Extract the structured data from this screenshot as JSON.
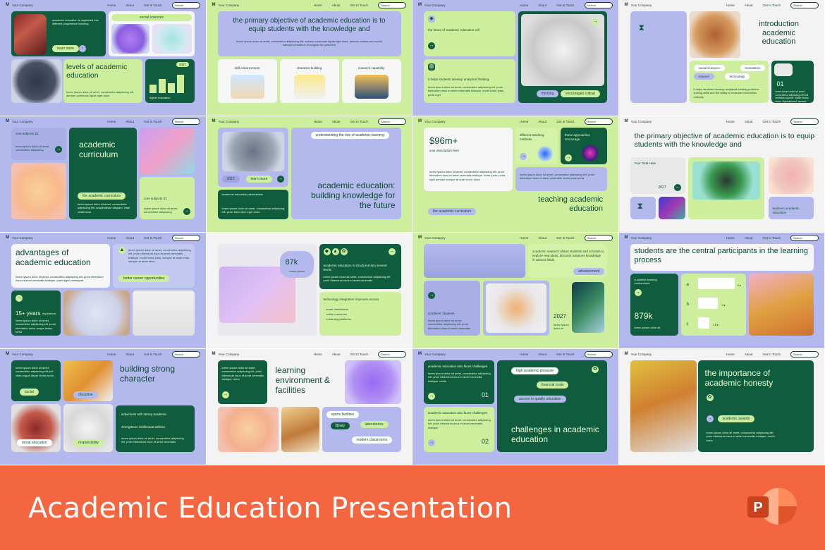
{
  "banner": {
    "title": "Academic Education Presentation"
  },
  "header": {
    "company": "Your Company",
    "home": "Home",
    "about": "About",
    "contact": "Get In Touch",
    "search": "Search"
  },
  "s1": {
    "t1": "academic education is organized into different progressive learning",
    "learn": "learn more",
    "social": "social sciences",
    "title": "levels of academic education",
    "year": "2027",
    "body": "lorem ipsum dolor sit amet, consectetur adipiscing elit, aenean commodo ligula eget dolor",
    "higher": "higher education"
  },
  "s2": {
    "title": "the primary objective of academic education is to equip students with the knowledge and",
    "body": "lorem ipsum dolor sit amet, consectetur adipiscing elit. aenean commodo ligula eget dolor. aenean massa cum sociis natoque penatibus et magnis dis parturient",
    "c1": "skill enhancement",
    "c2": "character building",
    "c3": "research capability"
  },
  "s3": {
    "t1": "the future of academic education will",
    "t2": "it helps students develop analytical thinking",
    "body": "lorem ipsum dolor sit amet, consectetur adipiscing elit. proin bibendum risus et amet venenatis tristique. morbi tortor justo, porta eget",
    "p1": "thinking",
    "p2": "encourages critical"
  },
  "s4": {
    "title": "introduction academic education",
    "p1": "social sciences",
    "p2": "humanities",
    "p3": "science",
    "p4": "technology",
    "num": "01",
    "body": "lorem ipsum dolor sit amet, consectetur adipiscing elit sed veritatus superet. disser lectus tortor, dignissimmet, aenean venenatis",
    "body2": "it helps students develop analytical thinking problem-solving skills and the ability to evaluate information critically"
  },
  "s5": {
    "c1": "core subjects 01",
    "b1": "lorem ipsum dolor sit amet, consectetur adipiscing",
    "title": "academic curriculum",
    "pill": "the academic curriculum",
    "body": "lorem ipsum dolor sit amet, consectetur adipiscing elit. suspendisse aliquam, vitae vestibulum",
    "c2": "core subjects 02",
    "b2": "lorem ipsum dolor sit amet, consectetur adipiscing"
  },
  "s6": {
    "year": "2027",
    "learn": "learn more",
    "top": "understanding the role of academic learning",
    "card": "academic education presentation",
    "body": "lorem ipsum dolor sit amet, consectetur adipiscing elit. proin bibendum eget dolor",
    "title": "academic education: building knowledge for the future"
  },
  "s7": {
    "value": "$96m+",
    "desc": "your description here",
    "body": "lorem ipsum dolor sit amet, consectetur adipiscing elit. proin bibendum risus et amet venenatis tristique. tortor justo, porta eget aenean semper at amet enim, diam",
    "c1": "different teaching methods",
    "c2": "these approaches encourage",
    "body2": "lorem ipsum dolor sit amet, consectetur adipiscing elit. proin bibendum risus et amet venenatis. tortor justo porta",
    "title": "teaching academic education",
    "pill": "the academic curriculum"
  },
  "s8": {
    "title": "the primary objective of academic education is to equip students with the knowledge and",
    "data": "Your Data Here",
    "year": "2027",
    "card": "teachers academic education"
  },
  "s9": {
    "title": "advantages of academic education",
    "body": "lorem ipsum dolor sit amet, consectetur adipiscing elit. proin bibendum risus et amet venenatis tristique. porta eget consequat",
    "b2": "lorem ipsum dolor sit amet, consectetur adipiscing elit. proin bibendum risus et amet venenatis tristique. morbi tortor justo, semper at amet enim, semper at amet enim",
    "pill": "better career opportunities",
    "stat": "15+ years",
    "exp": "experience",
    "body3": "lorem ipsum dolor sit amet, consectetur adipiscing elit. proin bibendum tortor, suspe lectus tortor"
  },
  "s10": {
    "stat": "87k",
    "lorem": "lorem ipsum",
    "t1": "academic education is structured into several levels",
    "b1": "lorem ipsum dolor sit amet, consectetur adipiscing elit. proin bibendum risus et amet venenatis",
    "t2": "technology integration improves access",
    "l1": "smart classrooms",
    "l2": "online resources",
    "l3": "e-learning platforms"
  },
  "s11": {
    "t1": "academic research allows students and scholars to explore new ideas, discover solutions knowledge in various fields.",
    "pill": "advancement",
    "t2": "academic students",
    "b2": "lorem ipsum dolor sit amet, consectetur adipiscing elit. proin bibendum risus et amet venenatis",
    "year": "2027",
    "b3": "lorem ipsum dolor sit"
  },
  "s12": {
    "title": "students are the central participants in the learning process",
    "c1": "a positive learning environment",
    "stat": "879k",
    "b1": "lorem ipsum dolor sit",
    "a": "a",
    "b": "b",
    "c": "c",
    "v1": "4 ▸",
    "v2": "5 ▸",
    "v3": "18 ▸"
  },
  "s13": {
    "b1": "lorem ipsum dolor sit amet, consectetur adipiscing elit sed vitae augue disser lectus tortor",
    "p1": "social",
    "p2": "discipline",
    "title": "building strong character",
    "i1": "individuals with strong academic",
    "i2": "strengthens intellectual abilities",
    "b2": "lorem ipsum dolor sit amet, consectetur adipiscing elit. proin bibendum risus et amet venenatis",
    "p3": "moral education",
    "p4": "responsibility"
  },
  "s14": {
    "b1": "lorem ipsum dolor sit amet, consectetur adipiscing elit. proin bibendum risus et amet venenatis tristique. tortor",
    "title": "learning environment & facilities",
    "p1": "sports facilities",
    "p2": "library",
    "p3": "laboratories",
    "p4": "modern classrooms"
  },
  "s15": {
    "t1": "academic education also faces challenges",
    "b1": "lorem ipsum dolor sit amet, consectetur adipiscing elit. proin bibendum risus et amet venenatis tristique. morbi",
    "n1": "01",
    "t2": "academic education also faces challenges",
    "b2": "lorem ipsum dolor sit amet, consectetur adipiscing elit. proin bibendum risus et amet venenatis tristique",
    "n2": "02",
    "p1": "high academic pressure",
    "p2": "financial costs",
    "p3": "access to quality education",
    "title": "challenges in academic education"
  },
  "s16": {
    "title": "the importance of academic honesty",
    "pill": "academic awards",
    "body": "lorem ipsum dolor sit amet, consectetur adipiscing elit. proin bibendum risus et amet venenatis tristique. morbi tortor"
  },
  "colors": {
    "dark_green": "#0f5c3f",
    "lime": "#cdee9c",
    "lavender": "#b3b9ec",
    "banner_orange": "#f4663f"
  }
}
